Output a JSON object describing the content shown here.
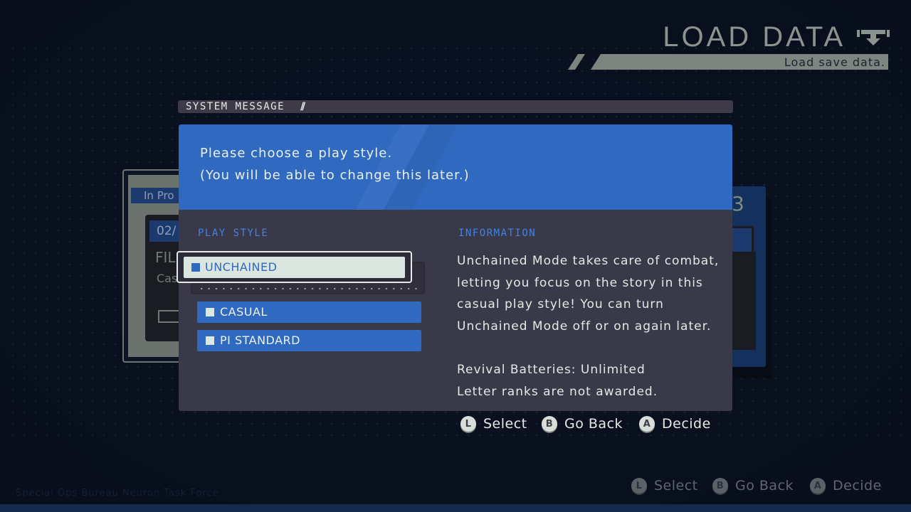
{
  "header": {
    "title": "LOAD DATA",
    "subtitle": "Load save data.",
    "icon": "download-tray-icon"
  },
  "background_cards": {
    "left": {
      "status": "In Pro",
      "date": "02/",
      "name": "FIL",
      "style": "Cas"
    },
    "right": {
      "slot_number": "3"
    }
  },
  "dialog": {
    "title": "SYSTEM MESSAGE",
    "title_decoration": "//",
    "message_lines": [
      "Please choose a play style.",
      "(You will be able to change this later.)"
    ],
    "play_style": {
      "label": "PLAY STYLE",
      "options": [
        {
          "label": "UNCHAINED",
          "selected": true
        },
        {
          "label": "CASUAL",
          "selected": false
        },
        {
          "label": "PI STANDARD",
          "selected": false
        }
      ]
    },
    "information": {
      "label": "INFORMATION",
      "lines": [
        "Unchained Mode takes care of combat,",
        "letting you focus on the story in this",
        "casual play style! You can turn",
        "Unchained Mode off or on again later."
      ],
      "details": [
        "Revival Batteries: Unlimited",
        "Letter ranks are not awarded."
      ]
    },
    "hints": [
      {
        "button": "L",
        "label": "Select"
      },
      {
        "button": "B",
        "label": "Go Back"
      },
      {
        "button": "A",
        "label": "Decide"
      }
    ]
  },
  "footer": {
    "text": "Special Ops Bureau  Neuron  Task  Force",
    "hints": [
      {
        "button": "L",
        "label": "Select"
      },
      {
        "button": "B",
        "label": "Go Back"
      },
      {
        "button": "A",
        "label": "Decide"
      }
    ]
  },
  "colors": {
    "background": "#0a1222",
    "accent_blue": "#2f69c0",
    "panel": "#3a3949",
    "label_blue": "#3f83e4",
    "selected_fill": "#dbe6e0"
  }
}
